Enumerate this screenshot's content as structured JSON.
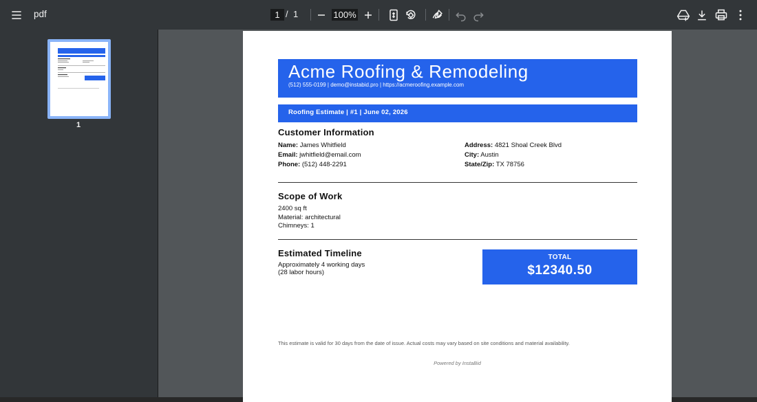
{
  "toolbar": {
    "title": "pdf",
    "page_current": "1",
    "page_separator": "/",
    "page_total": "1",
    "zoom": "100%"
  },
  "sidebar": {
    "thumbnail_label": "1"
  },
  "document": {
    "company": "Acme Roofing & Remodeling",
    "contact": "(512) 555-0199  |  demo@instabid.pro  |  https://acmeroofing.example.com",
    "estimate_line": "Roofing Estimate  |  #1  |  June 02, 2026",
    "customer_heading": "Customer Information",
    "name_label": "Name:",
    "name_value": "James Whitfield",
    "email_label": "Email:",
    "email_value": "jwhitfield@email.com",
    "phone_label": "Phone:",
    "phone_value": "(512) 448-2291",
    "address_label": "Address:",
    "address_value": "4821 Shoal Creek Blvd",
    "city_label": "City:",
    "city_value": "Austin",
    "statezip_label": "State/Zip:",
    "statezip_value": "TX 78756",
    "scope_heading": "Scope of Work",
    "scope_area": "2400 sq ft",
    "scope_material": "Material: architectural",
    "scope_chimneys": "Chimneys: 1",
    "timeline_heading": "Estimated Timeline",
    "timeline_days": "Approximately 4 working days",
    "timeline_hours": "(28 labor hours)",
    "total_label": "TOTAL",
    "total_value": "$12340.50",
    "disclaimer": "This estimate is valid for 30 days from the date of issue. Actual costs may vary based on site conditions and material availability.",
    "powered_by": "Powered by InstaBid"
  },
  "colors": {
    "brand_blue": "#2563eb",
    "toolbar_bg": "#323639",
    "viewer_bg": "#525659",
    "thumb_border": "#8ab4f8"
  }
}
